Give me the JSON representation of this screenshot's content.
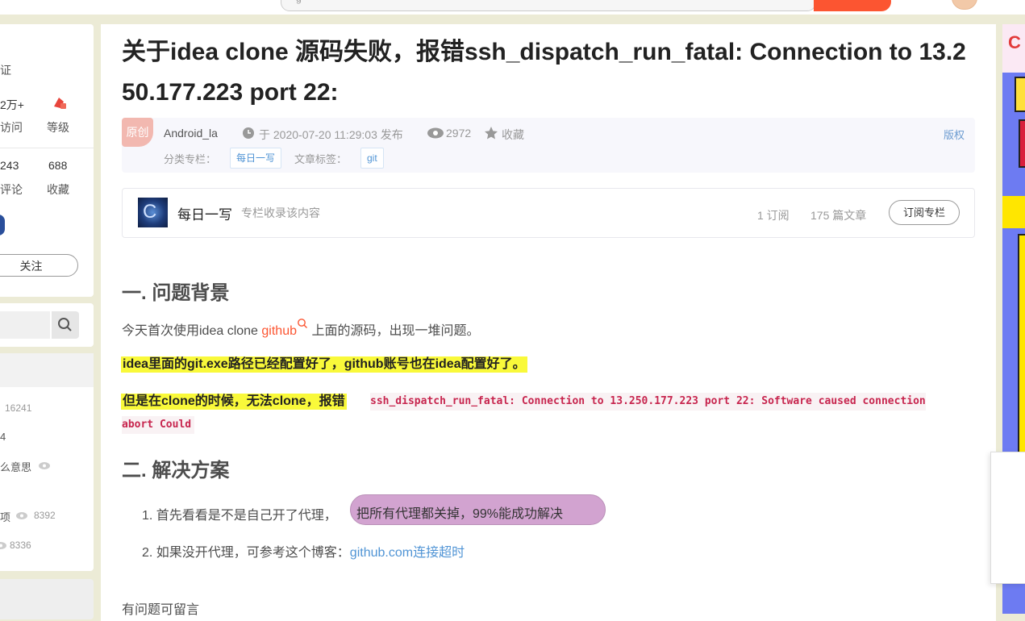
{
  "topnav": {
    "items": [
      "",
      "",
      "",
      "",
      "",
      ""
    ]
  },
  "sidebar": {
    "verify_label": "证",
    "visits_value": "2万+",
    "visits_label": "访问",
    "level_label": "等级",
    "comments_value": "243",
    "comments_label": "评论",
    "favorites_value": "688",
    "favorites_label": "收藏",
    "follow_label": "关注",
    "hot": [
      {
        "title": "",
        "count": "16241"
      },
      {
        "title": "4",
        "count": ""
      },
      {
        "title": "么意思",
        "count": ""
      },
      {
        "title": "项",
        "count": "8392"
      },
      {
        "title": "",
        "count": "8336"
      }
    ]
  },
  "article": {
    "title": "关于idea clone 源码失败，报错ssh_dispatch_run_fatal: Connection to 13.250.177.223 port 22:",
    "badge": "原创",
    "author": "Android_la",
    "publish": "于 2020-07-20 11:29:03 发布",
    "views": "2972",
    "favorite": "收藏",
    "copyright": "版权",
    "category_label": "分类专栏：",
    "category_tag": "每日一写",
    "tags_label": "文章标签：",
    "tag": "git"
  },
  "column": {
    "name": "每日一写",
    "desc": "专栏收录该内容",
    "subscribers": "1 订阅",
    "articles": "175 篇文章",
    "subscribe_btn": "订阅专栏"
  },
  "content": {
    "h1": "一. 问题背景",
    "p1_pre": "今天首次使用idea clone ",
    "p1_link": "github",
    "p1_post": " 上面的源码，出现一堆问题。",
    "hl1": "idea里面的git.exe路径已经配置好了，github账号也在idea配置好了。",
    "hl2": "但是在clone的时候，无法clone，报错",
    "code_line1": "ssh_dispatch_run_fatal: Connection to 13.250.177.223 port 22: Software caused connection",
    "code_line2": "abort Could",
    "h2": "二. 解决方案",
    "li1_pre": "1. 首先看看是不是自己开了代理，",
    "li1_pill": "把所有代理都关掉，99%能成功解决",
    "li2_pre": "2. 如果没开代理，可参考这个博客：",
    "li2_link": "github.com连接超时",
    "footer": "有问题可留言"
  }
}
